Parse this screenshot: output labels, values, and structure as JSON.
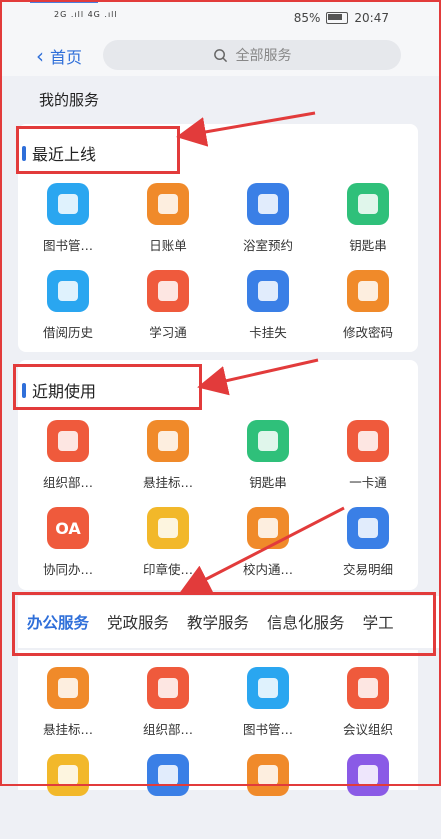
{
  "status": {
    "signal": "2G .ıll 4G .ıll",
    "battery": "85%",
    "time": "20:47"
  },
  "nav": {
    "back_label": "首页",
    "search_placeholder": "全部服务"
  },
  "my_services": "我的服务",
  "recent_online": {
    "title": "最近上线",
    "items": [
      {
        "label": "图书管…",
        "icon": "book-icon",
        "color": "#2aa6f0"
      },
      {
        "label": "日账单",
        "icon": "notepad-icon",
        "color": "#f08a2a"
      },
      {
        "label": "浴室预约",
        "icon": "building-icon",
        "color": "#3a7fe6"
      },
      {
        "label": "钥匙串",
        "icon": "key-ribbon-icon",
        "color": "#2fc07a"
      },
      {
        "label": "借阅历史",
        "icon": "book-history-icon",
        "color": "#2aa6f0"
      },
      {
        "label": "学习通",
        "icon": "graduation-cap-icon",
        "color": "#ef5a3c"
      },
      {
        "label": "卡挂失",
        "icon": "card-lost-icon",
        "color": "#3a7fe6"
      },
      {
        "label": "修改密码",
        "icon": "shield-lock-icon",
        "color": "#f08a2a"
      }
    ]
  },
  "recent_used": {
    "title": "近期使用",
    "items": [
      {
        "label": "组织部…",
        "icon": "org-dept-icon",
        "color": "#ef5a3c"
      },
      {
        "label": "悬挂标…",
        "icon": "banner-icon",
        "color": "#f08a2a"
      },
      {
        "label": "钥匙串",
        "icon": "key-ribbon-icon",
        "color": "#2fc07a"
      },
      {
        "label": "一卡通",
        "icon": "id-card-icon",
        "color": "#ef5a3c"
      },
      {
        "label": "协同办…",
        "icon": "oa-icon",
        "color": "#ef5a3c",
        "text": "OA"
      },
      {
        "label": "印章使…",
        "icon": "stamp-icon",
        "color": "#f2b82a"
      },
      {
        "label": "校内通…",
        "icon": "contacts-book-icon",
        "color": "#f08a2a"
      },
      {
        "label": "交易明细",
        "icon": "transaction-card-icon",
        "color": "#3a7fe6"
      }
    ]
  },
  "tabs": [
    "办公服务",
    "党政服务",
    "教学服务",
    "信息化服务",
    "学工"
  ],
  "office": {
    "items": [
      {
        "label": "悬挂标…",
        "icon": "banner-icon",
        "color": "#f08a2a"
      },
      {
        "label": "组织部…",
        "icon": "org-dept-icon",
        "color": "#ef5a3c"
      },
      {
        "label": "图书管…",
        "icon": "book-icon",
        "color": "#2aa6f0"
      },
      {
        "label": "会议组织",
        "icon": "meeting-icon",
        "color": "#ef5a3c"
      },
      {
        "label": "",
        "icon": "document-icon",
        "color": "#f2b82a"
      },
      {
        "label": "",
        "icon": "search-doc-icon",
        "color": "#3a7fe6"
      },
      {
        "label": "",
        "icon": "list-doc-icon",
        "color": "#f08a2a"
      },
      {
        "label": "",
        "icon": "archive-icon",
        "color": "#8a5ae6"
      }
    ]
  }
}
